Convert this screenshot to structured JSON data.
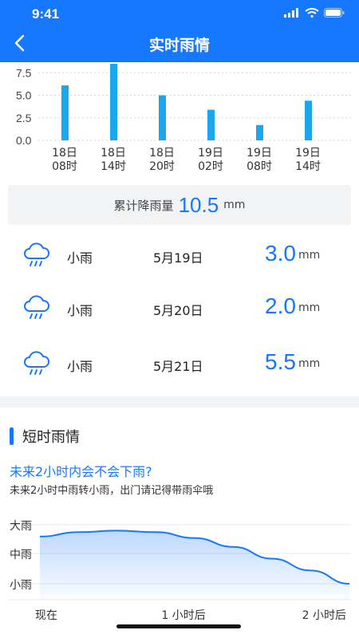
{
  "status_bar": {
    "time": "9:41"
  },
  "header": {
    "title": "实时雨情"
  },
  "rain_chart": {
    "type": "bar",
    "y_ticks": [
      "7.5",
      "5.0",
      "2.5",
      "0.0"
    ],
    "y_tick_values": [
      7.5,
      5.0,
      2.5,
      0.0
    ],
    "categories": [
      {
        "day": "18日",
        "hour": "08时"
      },
      {
        "day": "18日",
        "hour": "14时"
      },
      {
        "day": "18日",
        "hour": "20时"
      },
      {
        "day": "19日",
        "hour": "02时"
      },
      {
        "day": "19日",
        "hour": "08时"
      },
      {
        "day": "19日",
        "hour": "14时"
      }
    ],
    "values": [
      6.1,
      8.5,
      5.0,
      3.4,
      1.7,
      4.4
    ],
    "ylim": [
      0,
      8.5
    ],
    "grid": true,
    "bar_color": "#1aa7f0"
  },
  "total": {
    "label": "累计降雨量",
    "value": "10.5",
    "unit": "mm"
  },
  "daily": [
    {
      "icon": "rain-cloud-icon",
      "type": "小雨",
      "date": "5月19日",
      "value": "3.0",
      "unit": "mm"
    },
    {
      "icon": "rain-cloud-icon",
      "type": "小雨",
      "date": "5月20日",
      "value": "2.0",
      "unit": "mm"
    },
    {
      "icon": "rain-cloud-icon",
      "type": "小雨",
      "date": "5月21日",
      "value": "5.5",
      "unit": "mm"
    }
  ],
  "short_term": {
    "title": "短时雨情",
    "question": "未来2小时内会不会下雨?",
    "description": "未来2小时中雨转小雨，出门请记得带雨伞哦"
  },
  "chart_data": [
    {
      "type": "bar",
      "categories": [
        "18日08时",
        "18日14时",
        "18日20时",
        "19日02时",
        "19日08时",
        "19日14时"
      ],
      "values": [
        6.1,
        8.5,
        5.0,
        3.4,
        1.7,
        4.4
      ],
      "ylim": [
        0,
        8.5
      ],
      "grid": true
    },
    {
      "type": "area",
      "y_levels": [
        "大雨",
        "中雨",
        "小雨"
      ],
      "x_labels": [
        "现在",
        "1 小时后",
        "2 小时后"
      ],
      "x": [
        0,
        0.25,
        0.5,
        0.75,
        1.0,
        1.25,
        1.5,
        1.75,
        2.0
      ],
      "y": [
        1.6,
        1.75,
        1.8,
        1.75,
        1.55,
        1.25,
        0.85,
        0.45,
        0.0
      ],
      "ylim": [
        0,
        2.6
      ],
      "grid": true,
      "line_color": "#1677ff"
    }
  ],
  "trend_chart": {
    "y_levels": [
      "大雨",
      "中雨",
      "小雨"
    ],
    "x_labels": [
      "现在",
      "1 小时后",
      "2 小时后"
    ]
  }
}
